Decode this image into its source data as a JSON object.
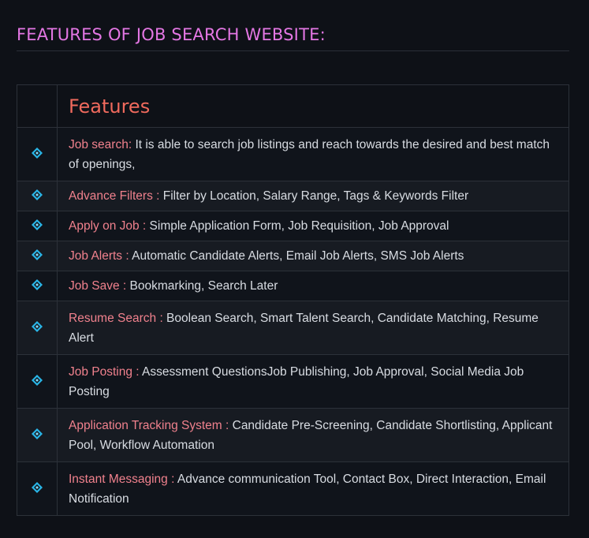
{
  "section": {
    "title": "FEATURES OF JOB SEARCH WEBSITE:"
  },
  "table": {
    "header": "Features",
    "rows": [
      {
        "term": "Job search:",
        "desc": " It is able to search job listings and reach towards the desired and best match of openings,"
      },
      {
        "term": "Advance Filters :",
        "desc": " Filter by Location, Salary Range, Tags & Keywords Filter"
      },
      {
        "term": "Apply on Job :",
        "desc": " Simple Application Form, Job Requisition, Job Approval"
      },
      {
        "term": "Job Alerts :",
        "desc": " Automatic Candidate Alerts, Email Job Alerts, SMS Job Alerts"
      },
      {
        "term": "Job Save :",
        "desc": " Bookmarking, Search Later"
      },
      {
        "term": "Resume Search :",
        "desc": " Boolean Search, Smart Talent Search, Candidate Matching, Resume Alert"
      },
      {
        "term": "Job Posting :",
        "desc": " Assessment QuestionsJob Publishing, Job Approval, Social Media Job Posting"
      },
      {
        "term": "Application Tracking System :",
        "desc": " Candidate Pre-Screening, Candidate Shortlisting, Applicant Pool, Workflow Automation"
      },
      {
        "term": "Instant Messaging :",
        "desc": " Advance communication Tool, Contact Box, Direct Interaction, Email Notification"
      }
    ]
  },
  "icon": "diamond-bullet-icon",
  "colors": {
    "background": "#0e1117",
    "heading": "#e477e4",
    "table_header": "#f06a5d",
    "term": "#f0818d",
    "body_text": "#d8dce2",
    "bullet": "#29b6e8"
  }
}
